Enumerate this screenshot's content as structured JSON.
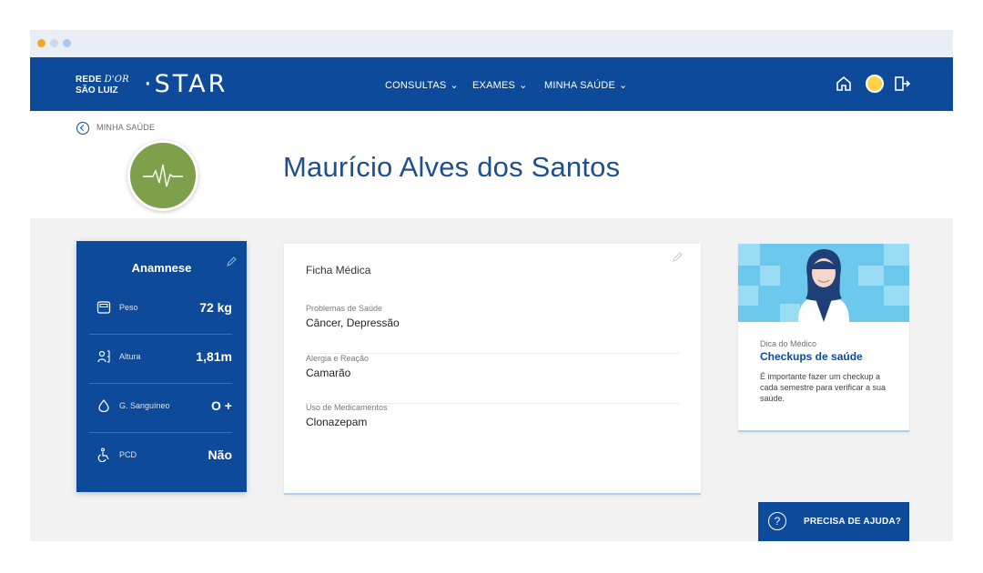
{
  "header": {
    "logo_line1": "REDE",
    "logo_dor": "D'OR",
    "logo_line2": "SÃO LUIZ",
    "brand": "·STAR",
    "menu": [
      {
        "label": "CONSULTAS"
      },
      {
        "label": "EXAMES"
      },
      {
        "label": "MINHA SAÚDE"
      }
    ],
    "icons": [
      "home-icon",
      "user-avatar",
      "logout-icon"
    ]
  },
  "breadcrumb": {
    "label": "MINHA SAÚDE"
  },
  "patient": {
    "name": "Maurício Alves dos Santos"
  },
  "anamnese": {
    "title": "Anamnese",
    "rows": [
      {
        "label": "Peso",
        "value": "72 kg",
        "icon": "scale-icon"
      },
      {
        "label": "Altura",
        "value": "1,81m",
        "icon": "height-icon"
      },
      {
        "label": "G. Sanguíneo",
        "value": "O +",
        "icon": "blood-drop-icon"
      },
      {
        "label": "PCD",
        "value": "Não",
        "icon": "wheelchair-icon"
      }
    ]
  },
  "ficha": {
    "title": "Ficha Médica",
    "fields": [
      {
        "label": "Problemas de Saúde",
        "value": "Câncer, Depressão"
      },
      {
        "label": "Alergia e Reação",
        "value": "Camarão"
      },
      {
        "label": "Uso de Medicamentos",
        "value": "Clonazepam"
      }
    ]
  },
  "dica": {
    "small": "Dica do Médico",
    "head": "Checkups de saúde",
    "body": "É importante fazer um checkup a cada semestre para verificar a sua saúde."
  },
  "help": {
    "label": "PRECISA DE AJUDA?"
  },
  "colors": {
    "primary": "#0d4a9a",
    "accent": "#7ea04a",
    "light_blue": "#66c5ea"
  }
}
